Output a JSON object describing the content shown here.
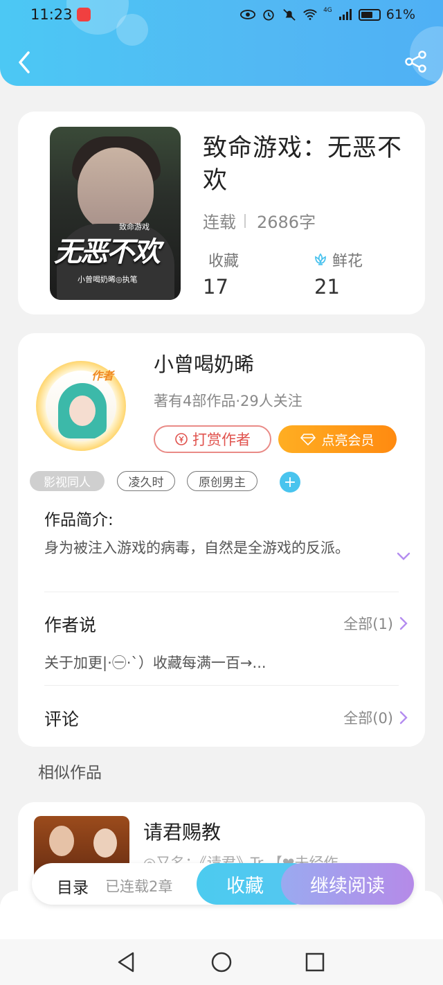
{
  "status_bar": {
    "time": "11:23",
    "network": "4G",
    "battery": "61%"
  },
  "header": {
    "back_icon": "chevron-left-icon",
    "share_icon": "share-icon"
  },
  "book": {
    "title": "致命游戏：无恶不欢",
    "cover_title": "无恶不欢",
    "cover_subtitle": "致命游戏",
    "cover_author": "小曾喝奶晞◎执笔",
    "status": "连载",
    "word_count": "2686字",
    "favorites_label": "收藏",
    "favorites_value": "17",
    "flowers_label": "鲜花",
    "flowers_value": "21"
  },
  "author": {
    "name": "小曾喝奶晞",
    "avatar_tag": "作者",
    "info": "著有4部作品·29人关注",
    "reward_label": "打赏作者",
    "vip_label": "点亮会员"
  },
  "tags": [
    "影视同人",
    "凌久时",
    "原创男主"
  ],
  "intro": {
    "heading": "作品简介:",
    "text": "身为被注入游戏的病毒，自然是全游戏的反派。"
  },
  "author_says": {
    "heading": "作者说",
    "all_label": "全部(1)",
    "preview": "关于加更|·㊀·`）收藏每满一百→..."
  },
  "comments": {
    "heading": "评论",
    "all_label": "全部(0)"
  },
  "similar": {
    "heading": "相似作品",
    "items": [
      {
        "title": "请君赐教",
        "alias": "◎又名：《请君》Tr 【❤未经作"
      }
    ]
  },
  "action_bar": {
    "toc_label": "目录",
    "toc_count": "已连载2章",
    "collect_label": "收藏",
    "read_label": "继续阅读"
  },
  "colors": {
    "header_blue": "#4fc0f4",
    "vip_orange": "#ff9a18",
    "reward_red": "#e0524d",
    "read_purple": "#b58ae8"
  }
}
